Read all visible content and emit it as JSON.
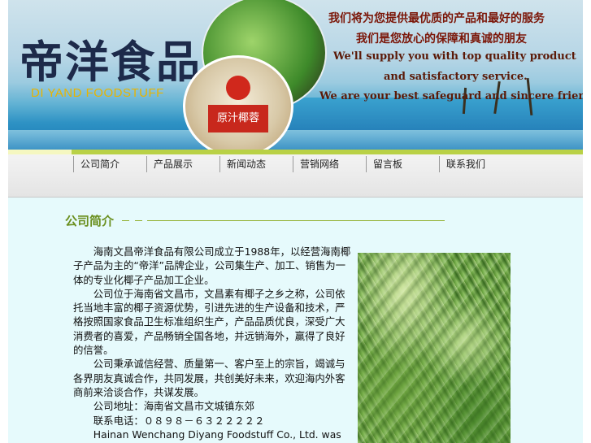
{
  "header": {
    "logo_cn": "帝洋食品",
    "logo_en": "DI YAND FOODSTUFF",
    "can_label": "原汁椰蓉",
    "slogans": [
      "我们将为您提供最优质的产品和最好的服务",
      "我们是您放心的保障和真诚的朋友",
      "We'll supply you with top quality product",
      "and satisfactory service.",
      "We are your best safeguard and sincere friend."
    ]
  },
  "nav": {
    "items": [
      "公司简介",
      "产品展示",
      "新闻动态",
      "营销网络",
      "留言板",
      "联系我们"
    ]
  },
  "main": {
    "title": "公司简介",
    "paragraphs": [
      "海南文昌帝洋食品有限公司成立于1988年，以经营海南椰子产品为主的“帝洋”品牌企业，公司集生产、加工、销售为一体的专业化椰子产品加工企业。",
      "公司位于海南省文昌市，文昌素有椰子之乡之称，公司依托当地丰富的椰子资源优势，引进先进的生产设备和技术，严格按照国家食品卫生标准组织生产，产品品质优良，深受广大消费者的喜爱，产品畅销全国各地，并远销海外，赢得了良好的信誉。",
      "公司秉承诚信经营、质量第一、客户至上的宗旨，竭诚与各界朋友真诚合作，共同发展，共创美好未来，欢迎海内外客商前来洽谈合作，共谋发展。",
      "公司地址：海南省文昌市文城镇东郊",
      "联系电话：０８９８－６３２２２２２",
      "Hainan Wenchang Diyang Foodstuff Co., Ltd. was"
    ]
  },
  "colors": {
    "nav_accent": "#b9d146",
    "title_green": "#6a8f1e",
    "page_bg": "#e6fafc",
    "slogan_red": "#7b1608"
  }
}
